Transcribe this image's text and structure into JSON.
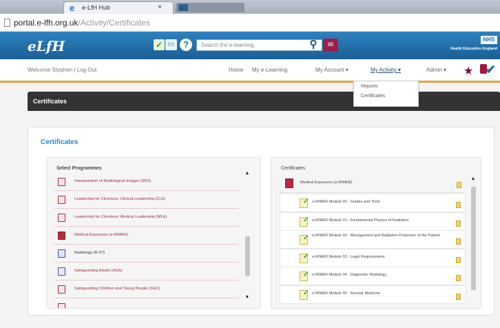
{
  "browser": {
    "tab_title": "e-LfH Hub",
    "tab_close": "×",
    "url_domain": "portal.e-lfh.org.uk",
    "url_path": "/Activity/Certificates"
  },
  "header": {
    "logo": "eLfH",
    "search_placeholder": "Search the e-learning",
    "nhs_logo": "NHS",
    "hee_text": "Health Education England"
  },
  "nav": {
    "welcome": "Welcome Stephen | Log Out",
    "items": [
      "Home",
      "My e-Learning",
      "My Account ▾",
      "My Activity ▾",
      "Admin ▾"
    ]
  },
  "dropdown": {
    "items": [
      "Reports",
      "Certificates"
    ]
  },
  "page": {
    "bar_title": "Certificates",
    "card_title": "Certificates"
  },
  "programmes": {
    "heading": "Select Programmes",
    "items": [
      {
        "label": "Interpretation of Radiological Images (IRIS)",
        "icon": "red"
      },
      {
        "label": "Leadership for Clinicians: Clinical Leadership (CLE)",
        "icon": "red"
      },
      {
        "label": "Leadership for Clinicians: Medical Leadership (MLE)",
        "icon": "red"
      },
      {
        "label": "Medical Exposures (e-RIMER)",
        "icon": "filled"
      },
      {
        "label": "Radiology (R-ITI)",
        "icon": "blue"
      },
      {
        "label": "Safeguarding Adults (SGA)",
        "icon": "gray"
      },
      {
        "label": "Safeguarding Children and Young People (SGC)",
        "icon": "red"
      },
      {
        "label": "",
        "icon": "red"
      }
    ]
  },
  "certificates": {
    "heading": "Certificates",
    "top_item": "Medical Exposures (e-RIMER)",
    "items": [
      "e-RIMER Module 00 - Guides and Tools",
      "e-RIMER Module 01 - Fundamental Physics of Radiation",
      "e-RIMER Module 02 - Management and Radiation Protection of the Patient",
      "e-RIMER Module 03 - Legal Requirements",
      "e-RIMER Module 04 - Diagnostic Radiology",
      "e-RIMER Module 05 - Nuclear Medicine"
    ]
  },
  "icons": {
    "search": "search-icon",
    "help": "help-icon",
    "star": "star-icon",
    "mail": "mail-icon"
  },
  "colors": {
    "header_blue": "#1f6fa8",
    "accent_orange": "#e8a23a",
    "title_blue": "#1f8bd0",
    "programme_red": "#a6283d"
  }
}
